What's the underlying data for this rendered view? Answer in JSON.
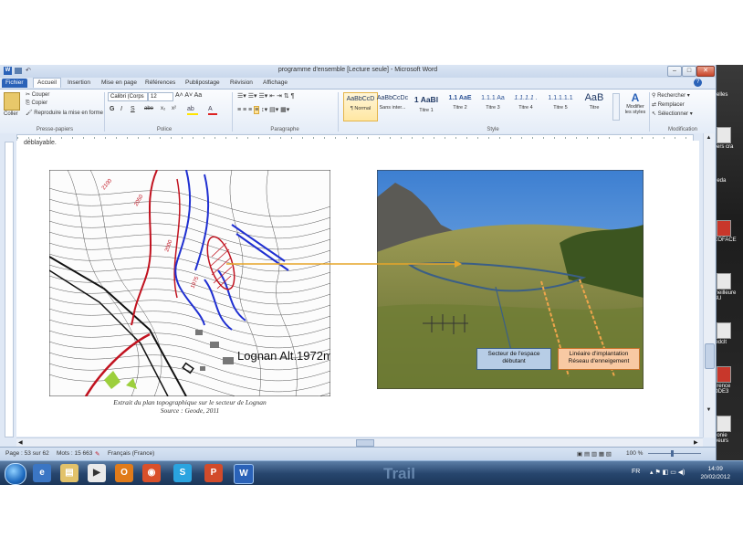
{
  "window": {
    "title": "programme d'ensemble [Lecture seule] - Microsoft Word",
    "min": "–",
    "max": "□",
    "close": "✕"
  },
  "tabs": [
    "Fichier",
    "Accueil",
    "Insertion",
    "Mise en page",
    "Références",
    "Publipostage",
    "Révision",
    "Affichage"
  ],
  "ribbon": {
    "clipboard": {
      "paste": "Coller",
      "cut": "Couper",
      "copy": "Copier",
      "format_painter": "Reproduire la mise en forme",
      "label": "Presse-papiers"
    },
    "font": {
      "name": "Calibri (Corps",
      "size": "12",
      "bold": "G",
      "italic": "I",
      "underline": "S",
      "strike": "abe",
      "sub": "x₂",
      "sup": "x²",
      "label": "Police"
    },
    "paragraph": {
      "label": "Paragraphe"
    },
    "styles": {
      "items": [
        {
          "sample": "AaBbCcD",
          "name": "¶ Normal"
        },
        {
          "sample": "AaBbCcDc",
          "name": "Sans inter..."
        },
        {
          "sample": "1 AaBl",
          "name": "Titre 1"
        },
        {
          "sample": "1.1 AaE",
          "name": "Titre 2"
        },
        {
          "sample": "1.1.1 Aa",
          "name": "Titre 3"
        },
        {
          "sample": "1.1.1.1 .",
          "name": "Titre 4"
        },
        {
          "sample": "1.1.1.1.1",
          "name": "Titre 5"
        },
        {
          "sample": "AaB",
          "name": "Titre"
        }
      ],
      "change": "Modifier les styles",
      "label": "Style"
    },
    "editing": {
      "find": "Rechercher",
      "replace": "Remplacer",
      "select": "Sélectionner",
      "label": "Modification"
    }
  },
  "document": {
    "top_text": "déblayable.",
    "map_label": "Lognan Alt.1972m.",
    "map_caption_1": "Extrait du plan topographique  sur  le secteur de Lognan",
    "map_caption_2": "Source : Geode, 2011",
    "photo_label_1": "Secteur de l'espace débutant",
    "photo_label_2": "Linéaire d'implantation Réseau d'enneigement",
    "contours": [
      "2050",
      "2000",
      "2100",
      "1975"
    ]
  },
  "statusbar": {
    "page": "Page : 53 sur 62",
    "words": "Mots : 15 663",
    "lang": "Français (France)",
    "zoom": "100 %"
  },
  "taskbar": {
    "lang": "FR",
    "time": "14:09",
    "date": "20/02/2012",
    "bg_text": "Trail"
  },
  "desktop": [
    "velles",
    "vers cra",
    "neda",
    "COFACE",
    "meilleure BU",
    "ledclt",
    "érence ODE3",
    "ponie iveurs"
  ],
  "colors": {
    "accent": "#2a62b8",
    "taskbar": "#27466e",
    "label_blue": "#b7cde6",
    "label_orange": "#f8c9a3"
  }
}
